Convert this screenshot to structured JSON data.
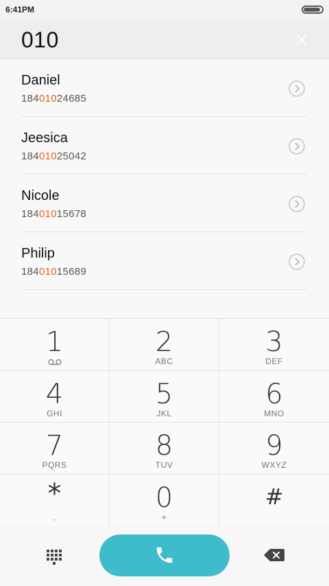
{
  "status": {
    "time": "6:41PM",
    "battery_level": 0.95
  },
  "search": {
    "input": "010",
    "clear_icon": "close-icon"
  },
  "results": [
    {
      "name": "Daniel",
      "pre": "184",
      "match": "010",
      "post": "24685"
    },
    {
      "name": "Jeesica",
      "pre": "184",
      "match": "010",
      "post": "25042"
    },
    {
      "name": "Nicole",
      "pre": "184",
      "match": "010",
      "post": "15678"
    },
    {
      "name": "Philip",
      "pre": "184",
      "match": "010",
      "post": "15689"
    }
  ],
  "keypad": {
    "k1": {
      "digit": "1",
      "letters": ""
    },
    "k2": {
      "digit": "2",
      "letters": "ABC"
    },
    "k3": {
      "digit": "3",
      "letters": "DEF"
    },
    "k4": {
      "digit": "4",
      "letters": "GHI"
    },
    "k5": {
      "digit": "5",
      "letters": "JKL"
    },
    "k6": {
      "digit": "6",
      "letters": "MNO"
    },
    "k7": {
      "digit": "7",
      "letters": "PQRS"
    },
    "k8": {
      "digit": "8",
      "letters": "TUV"
    },
    "k9": {
      "digit": "9",
      "letters": "WXYZ"
    },
    "kstar": {
      "digit": "*",
      "letters": ","
    },
    "k0": {
      "digit": "0",
      "letters": "+"
    },
    "khash": {
      "digit": "#",
      "letters": ""
    }
  },
  "icons": {
    "clear": "close-icon",
    "detail": "chevron-right-circle-icon",
    "voicemail": "voicemail-icon",
    "dialpad": "dialpad-grid-icon",
    "call": "phone-icon",
    "backspace": "backspace-icon"
  },
  "colors": {
    "accent": "#3fbccb",
    "match": "#e8611f"
  }
}
